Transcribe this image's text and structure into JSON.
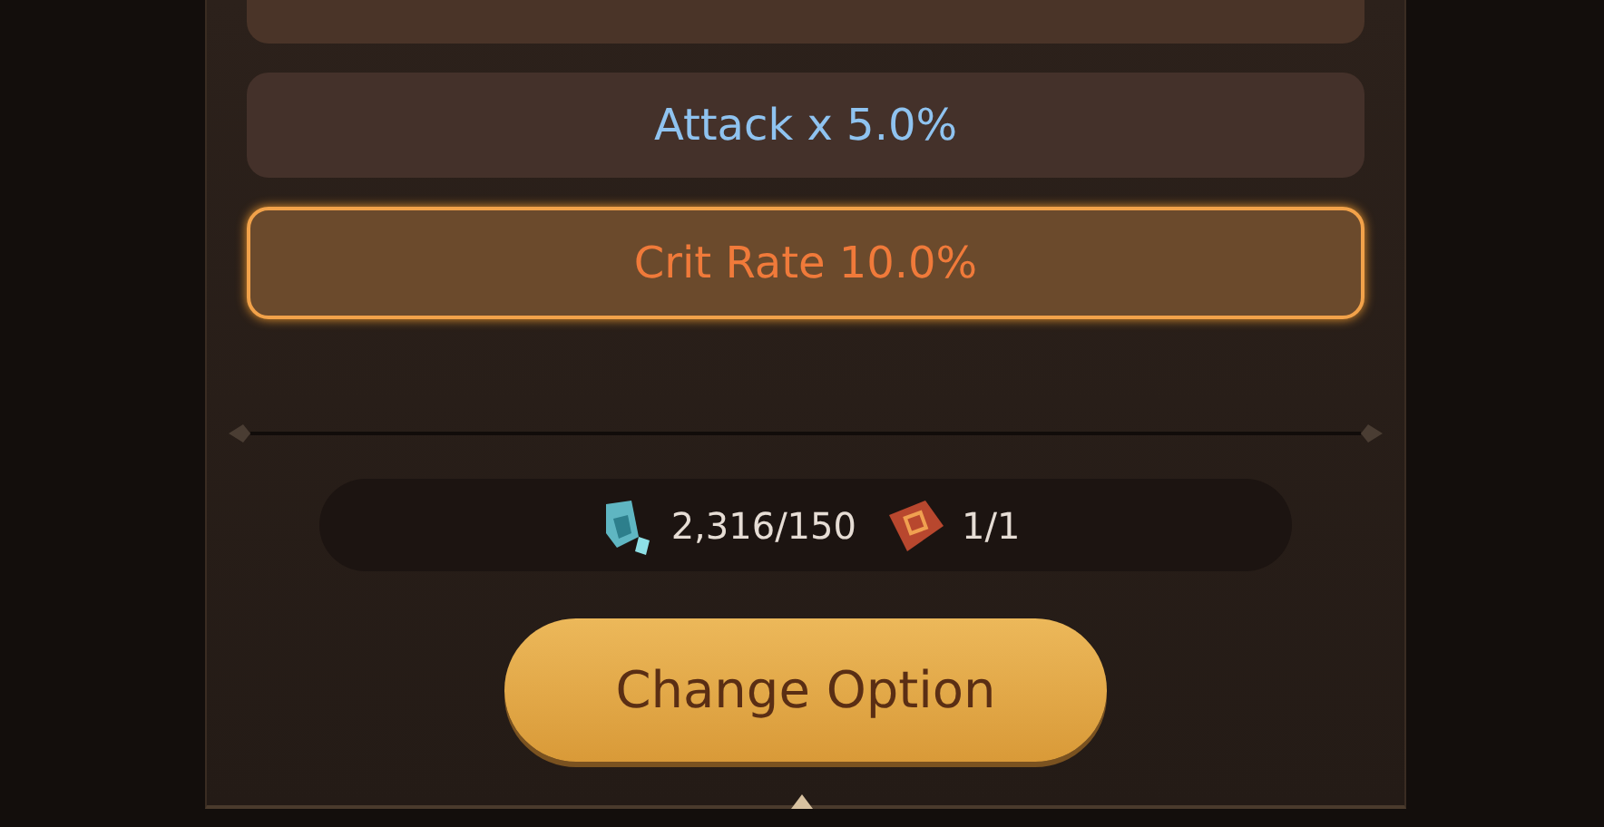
{
  "options": [
    {
      "label": "Attack x 5.0%",
      "selected": false,
      "color": "#8fc3f0"
    },
    {
      "label": "Crit Rate 10.0%",
      "selected": true,
      "color": "#f07a3a"
    }
  ],
  "costs": [
    {
      "kind": "crystal",
      "amount": "2,316/150"
    },
    {
      "kind": "scroll",
      "amount": "1/1"
    }
  ],
  "button": {
    "label": "Change Option"
  }
}
